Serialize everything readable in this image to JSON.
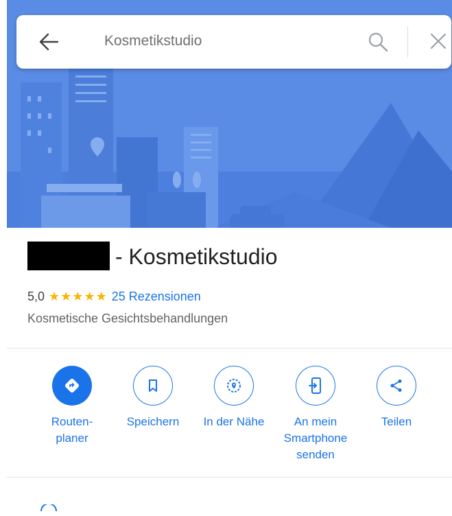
{
  "search": {
    "query": "Kosmetikstudio"
  },
  "place": {
    "title": "- Kosmetikstudio",
    "rating": "5,0",
    "stars": "★★★★★",
    "reviews_label": "25 Rezensionen",
    "category": "Kosmetische Gesichtsbehandlungen"
  },
  "actions": [
    {
      "label": "Routen-\nplaner",
      "icon": "directions-icon"
    },
    {
      "label": "Speichern",
      "icon": "bookmark-icon"
    },
    {
      "label": "In der Nähe",
      "icon": "nearby-icon"
    },
    {
      "label": "An mein\nSmartphone\nsenden",
      "icon": "send-to-phone-icon"
    },
    {
      "label": "Teilen",
      "icon": "share-icon"
    }
  ],
  "colors": {
    "accent": "#1a73e8",
    "star": "#f9b400",
    "hero_sky": "#5b8de8"
  }
}
